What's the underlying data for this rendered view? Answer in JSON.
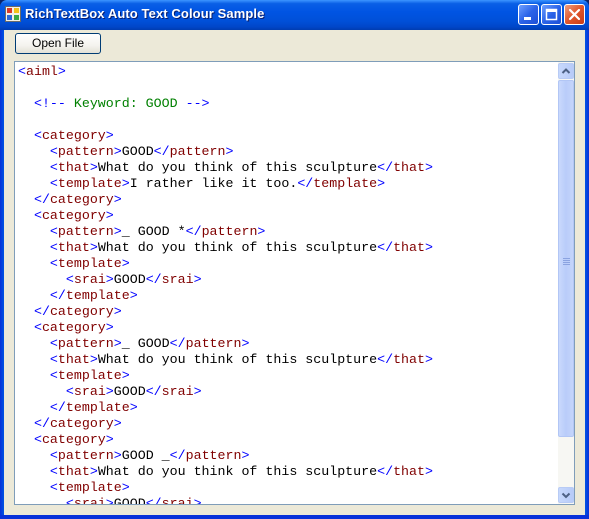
{
  "window": {
    "title": "RichTextBox Auto Text Colour Sample",
    "controls": [
      "minimize",
      "maximize",
      "close"
    ]
  },
  "toolbar": {
    "open_file_label": "Open File"
  },
  "colors": {
    "bracket": "#0000ff",
    "tag_name": "#800000",
    "comment": "#008000",
    "text": "#000000"
  },
  "editor": {
    "scroll_position": 0,
    "visible_fraction": 0.88,
    "lines": [
      [
        {
          "t": "br",
          "v": "<"
        },
        {
          "t": "tg",
          "v": "aiml"
        },
        {
          "t": "br",
          "v": ">"
        }
      ],
      [],
      [
        {
          "t": "tx",
          "v": "  "
        },
        {
          "t": "br",
          "v": "<!--"
        },
        {
          "t": "cm",
          "v": " Keyword: GOOD "
        },
        {
          "t": "br",
          "v": "-->"
        }
      ],
      [],
      [
        {
          "t": "tx",
          "v": "  "
        },
        {
          "t": "br",
          "v": "<"
        },
        {
          "t": "tg",
          "v": "category"
        },
        {
          "t": "br",
          "v": ">"
        }
      ],
      [
        {
          "t": "tx",
          "v": "    "
        },
        {
          "t": "br",
          "v": "<"
        },
        {
          "t": "tg",
          "v": "pattern"
        },
        {
          "t": "br",
          "v": ">"
        },
        {
          "t": "tx",
          "v": "GOOD"
        },
        {
          "t": "br",
          "v": "</"
        },
        {
          "t": "tg",
          "v": "pattern"
        },
        {
          "t": "br",
          "v": ">"
        }
      ],
      [
        {
          "t": "tx",
          "v": "    "
        },
        {
          "t": "br",
          "v": "<"
        },
        {
          "t": "tg",
          "v": "that"
        },
        {
          "t": "br",
          "v": ">"
        },
        {
          "t": "tx",
          "v": "What do you think of this sculpture"
        },
        {
          "t": "br",
          "v": "</"
        },
        {
          "t": "tg",
          "v": "that"
        },
        {
          "t": "br",
          "v": ">"
        }
      ],
      [
        {
          "t": "tx",
          "v": "    "
        },
        {
          "t": "br",
          "v": "<"
        },
        {
          "t": "tg",
          "v": "template"
        },
        {
          "t": "br",
          "v": ">"
        },
        {
          "t": "tx",
          "v": "I rather like it too."
        },
        {
          "t": "br",
          "v": "</"
        },
        {
          "t": "tg",
          "v": "template"
        },
        {
          "t": "br",
          "v": ">"
        }
      ],
      [
        {
          "t": "tx",
          "v": "  "
        },
        {
          "t": "br",
          "v": "</"
        },
        {
          "t": "tg",
          "v": "category"
        },
        {
          "t": "br",
          "v": ">"
        }
      ],
      [
        {
          "t": "tx",
          "v": "  "
        },
        {
          "t": "br",
          "v": "<"
        },
        {
          "t": "tg",
          "v": "category"
        },
        {
          "t": "br",
          "v": ">"
        }
      ],
      [
        {
          "t": "tx",
          "v": "    "
        },
        {
          "t": "br",
          "v": "<"
        },
        {
          "t": "tg",
          "v": "pattern"
        },
        {
          "t": "br",
          "v": ">"
        },
        {
          "t": "tx",
          "v": "_ GOOD *"
        },
        {
          "t": "br",
          "v": "</"
        },
        {
          "t": "tg",
          "v": "pattern"
        },
        {
          "t": "br",
          "v": ">"
        }
      ],
      [
        {
          "t": "tx",
          "v": "    "
        },
        {
          "t": "br",
          "v": "<"
        },
        {
          "t": "tg",
          "v": "that"
        },
        {
          "t": "br",
          "v": ">"
        },
        {
          "t": "tx",
          "v": "What do you think of this sculpture"
        },
        {
          "t": "br",
          "v": "</"
        },
        {
          "t": "tg",
          "v": "that"
        },
        {
          "t": "br",
          "v": ">"
        }
      ],
      [
        {
          "t": "tx",
          "v": "    "
        },
        {
          "t": "br",
          "v": "<"
        },
        {
          "t": "tg",
          "v": "template"
        },
        {
          "t": "br",
          "v": ">"
        }
      ],
      [
        {
          "t": "tx",
          "v": "      "
        },
        {
          "t": "br",
          "v": "<"
        },
        {
          "t": "tg",
          "v": "srai"
        },
        {
          "t": "br",
          "v": ">"
        },
        {
          "t": "tx",
          "v": "GOOD"
        },
        {
          "t": "br",
          "v": "</"
        },
        {
          "t": "tg",
          "v": "srai"
        },
        {
          "t": "br",
          "v": ">"
        }
      ],
      [
        {
          "t": "tx",
          "v": "    "
        },
        {
          "t": "br",
          "v": "</"
        },
        {
          "t": "tg",
          "v": "template"
        },
        {
          "t": "br",
          "v": ">"
        }
      ],
      [
        {
          "t": "tx",
          "v": "  "
        },
        {
          "t": "br",
          "v": "</"
        },
        {
          "t": "tg",
          "v": "category"
        },
        {
          "t": "br",
          "v": ">"
        }
      ],
      [
        {
          "t": "tx",
          "v": "  "
        },
        {
          "t": "br",
          "v": "<"
        },
        {
          "t": "tg",
          "v": "category"
        },
        {
          "t": "br",
          "v": ">"
        }
      ],
      [
        {
          "t": "tx",
          "v": "    "
        },
        {
          "t": "br",
          "v": "<"
        },
        {
          "t": "tg",
          "v": "pattern"
        },
        {
          "t": "br",
          "v": ">"
        },
        {
          "t": "tx",
          "v": "_ GOOD"
        },
        {
          "t": "br",
          "v": "</"
        },
        {
          "t": "tg",
          "v": "pattern"
        },
        {
          "t": "br",
          "v": ">"
        }
      ],
      [
        {
          "t": "tx",
          "v": "    "
        },
        {
          "t": "br",
          "v": "<"
        },
        {
          "t": "tg",
          "v": "that"
        },
        {
          "t": "br",
          "v": ">"
        },
        {
          "t": "tx",
          "v": "What do you think of this sculpture"
        },
        {
          "t": "br",
          "v": "</"
        },
        {
          "t": "tg",
          "v": "that"
        },
        {
          "t": "br",
          "v": ">"
        }
      ],
      [
        {
          "t": "tx",
          "v": "    "
        },
        {
          "t": "br",
          "v": "<"
        },
        {
          "t": "tg",
          "v": "template"
        },
        {
          "t": "br",
          "v": ">"
        }
      ],
      [
        {
          "t": "tx",
          "v": "      "
        },
        {
          "t": "br",
          "v": "<"
        },
        {
          "t": "tg",
          "v": "srai"
        },
        {
          "t": "br",
          "v": ">"
        },
        {
          "t": "tx",
          "v": "GOOD"
        },
        {
          "t": "br",
          "v": "</"
        },
        {
          "t": "tg",
          "v": "srai"
        },
        {
          "t": "br",
          "v": ">"
        }
      ],
      [
        {
          "t": "tx",
          "v": "    "
        },
        {
          "t": "br",
          "v": "</"
        },
        {
          "t": "tg",
          "v": "template"
        },
        {
          "t": "br",
          "v": ">"
        }
      ],
      [
        {
          "t": "tx",
          "v": "  "
        },
        {
          "t": "br",
          "v": "</"
        },
        {
          "t": "tg",
          "v": "category"
        },
        {
          "t": "br",
          "v": ">"
        }
      ],
      [
        {
          "t": "tx",
          "v": "  "
        },
        {
          "t": "br",
          "v": "<"
        },
        {
          "t": "tg",
          "v": "category"
        },
        {
          "t": "br",
          "v": ">"
        }
      ],
      [
        {
          "t": "tx",
          "v": "    "
        },
        {
          "t": "br",
          "v": "<"
        },
        {
          "t": "tg",
          "v": "pattern"
        },
        {
          "t": "br",
          "v": ">"
        },
        {
          "t": "tx",
          "v": "GOOD _"
        },
        {
          "t": "br",
          "v": "</"
        },
        {
          "t": "tg",
          "v": "pattern"
        },
        {
          "t": "br",
          "v": ">"
        }
      ],
      [
        {
          "t": "tx",
          "v": "    "
        },
        {
          "t": "br",
          "v": "<"
        },
        {
          "t": "tg",
          "v": "that"
        },
        {
          "t": "br",
          "v": ">"
        },
        {
          "t": "tx",
          "v": "What do you think of this sculpture"
        },
        {
          "t": "br",
          "v": "</"
        },
        {
          "t": "tg",
          "v": "that"
        },
        {
          "t": "br",
          "v": ">"
        }
      ],
      [
        {
          "t": "tx",
          "v": "    "
        },
        {
          "t": "br",
          "v": "<"
        },
        {
          "t": "tg",
          "v": "template"
        },
        {
          "t": "br",
          "v": ">"
        }
      ],
      [
        {
          "t": "tx",
          "v": "      "
        },
        {
          "t": "br",
          "v": "<"
        },
        {
          "t": "tg",
          "v": "srai"
        },
        {
          "t": "br",
          "v": ">"
        },
        {
          "t": "tx",
          "v": "GOOD"
        },
        {
          "t": "br",
          "v": "</"
        },
        {
          "t": "tg",
          "v": "srai"
        },
        {
          "t": "br",
          "v": ">"
        }
      ]
    ]
  }
}
